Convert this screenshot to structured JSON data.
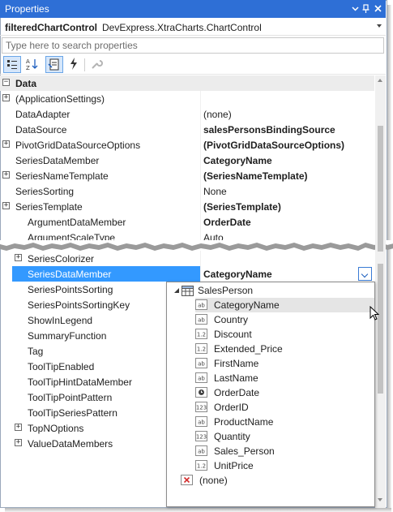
{
  "window": {
    "title": "Properties"
  },
  "object_selector": {
    "name": "filteredChartControl",
    "type": "DevExpress.XtraCharts.ChartControl"
  },
  "search": {
    "placeholder": "Type here to search properties"
  },
  "toolbar": {
    "buttons": [
      {
        "icon": "categorized-icon",
        "active": true
      },
      {
        "icon": "alphabetical-icon",
        "active": false
      },
      {
        "icon": "properties-icon",
        "active": true
      },
      {
        "icon": "events-icon",
        "active": false
      },
      {
        "icon": "wrench-icon",
        "active": false
      }
    ]
  },
  "grid_top": {
    "category": "Data",
    "rows": [
      {
        "name": "(ApplicationSettings)",
        "value": "",
        "expandable": true,
        "indent": 0,
        "bold": false
      },
      {
        "name": "DataAdapter",
        "value": "(none)",
        "expandable": false,
        "indent": 0,
        "bold": false
      },
      {
        "name": "DataSource",
        "value": "salesPersonsBindingSource",
        "expandable": false,
        "indent": 0,
        "bold": true
      },
      {
        "name": "PivotGridDataSourceOptions",
        "value": "(PivotGridDataSourceOptions)",
        "expandable": true,
        "indent": 0,
        "bold": true
      },
      {
        "name": "SeriesDataMember",
        "value": "CategoryName",
        "expandable": false,
        "indent": 0,
        "bold": true
      },
      {
        "name": "SeriesNameTemplate",
        "value": "(SeriesNameTemplate)",
        "expandable": true,
        "indent": 0,
        "bold": true
      },
      {
        "name": "SeriesSorting",
        "value": "None",
        "expandable": false,
        "indent": 0,
        "bold": false
      },
      {
        "name": "SeriesTemplate",
        "value": "(SeriesTemplate)",
        "expandable": true,
        "indent": 0,
        "bold": true
      },
      {
        "name": "ArgumentDataMember",
        "value": "OrderDate",
        "expandable": false,
        "indent": 1,
        "bold": true
      },
      {
        "name": "ArgumentScaleType",
        "value": "Auto",
        "expandable": false,
        "indent": 1,
        "bold": false
      }
    ]
  },
  "grid_bottom": {
    "rows": [
      {
        "name": "SeriesColorizer",
        "value": "",
        "expandable": true,
        "indent": 1,
        "bold": false,
        "selected": false
      },
      {
        "name": "SeriesDataMember",
        "value": "CategoryName",
        "expandable": false,
        "indent": 1,
        "bold": true,
        "selected": true
      },
      {
        "name": "SeriesPointsSorting",
        "value": "",
        "expandable": false,
        "indent": 1,
        "bold": false,
        "selected": false
      },
      {
        "name": "SeriesPointsSortingKey",
        "value": "",
        "expandable": false,
        "indent": 1,
        "bold": false,
        "selected": false
      },
      {
        "name": "ShowInLegend",
        "value": "",
        "expandable": false,
        "indent": 1,
        "bold": false,
        "selected": false
      },
      {
        "name": "SummaryFunction",
        "value": "",
        "expandable": false,
        "indent": 1,
        "bold": false,
        "selected": false
      },
      {
        "name": "Tag",
        "value": "",
        "expandable": false,
        "indent": 1,
        "bold": false,
        "selected": false
      },
      {
        "name": "ToolTipEnabled",
        "value": "",
        "expandable": false,
        "indent": 1,
        "bold": false,
        "selected": false
      },
      {
        "name": "ToolTipHintDataMember",
        "value": "",
        "expandable": false,
        "indent": 1,
        "bold": false,
        "selected": false
      },
      {
        "name": "ToolTipPointPattern",
        "value": "",
        "expandable": false,
        "indent": 1,
        "bold": false,
        "selected": false
      },
      {
        "name": "ToolTipSeriesPattern",
        "value": "",
        "expandable": false,
        "indent": 1,
        "bold": false,
        "selected": false
      },
      {
        "name": "TopNOptions",
        "value": "",
        "expandable": true,
        "indent": 1,
        "bold": false,
        "selected": false
      },
      {
        "name": "ValueDataMembers",
        "value": "",
        "expandable": true,
        "indent": 1,
        "bold": false,
        "selected": false
      }
    ]
  },
  "dropdown": {
    "root": "SalesPerson",
    "root_icon": "table-icon",
    "fields": [
      {
        "label": "CategoryName",
        "icon": "ab",
        "highlighted": true
      },
      {
        "label": "Country",
        "icon": "ab",
        "highlighted": false
      },
      {
        "label": "Discount",
        "icon": "1.2",
        "highlighted": false
      },
      {
        "label": "Extended_Price",
        "icon": "1.2",
        "highlighted": false
      },
      {
        "label": "FirstName",
        "icon": "ab",
        "highlighted": false
      },
      {
        "label": "LastName",
        "icon": "ab",
        "highlighted": false
      },
      {
        "label": "OrderDate",
        "icon": "clock",
        "highlighted": false
      },
      {
        "label": "OrderID",
        "icon": "123",
        "highlighted": false
      },
      {
        "label": "ProductName",
        "icon": "ab",
        "highlighted": false
      },
      {
        "label": "Quantity",
        "icon": "123",
        "highlighted": false
      },
      {
        "label": "Sales_Person",
        "icon": "ab",
        "highlighted": false
      },
      {
        "label": "UnitPrice",
        "icon": "1.2",
        "highlighted": false
      }
    ],
    "none_label": "(none)"
  },
  "colors": {
    "title_bar": "#2e6fd6",
    "selection": "#3399ff",
    "category_row": "#ececec"
  }
}
